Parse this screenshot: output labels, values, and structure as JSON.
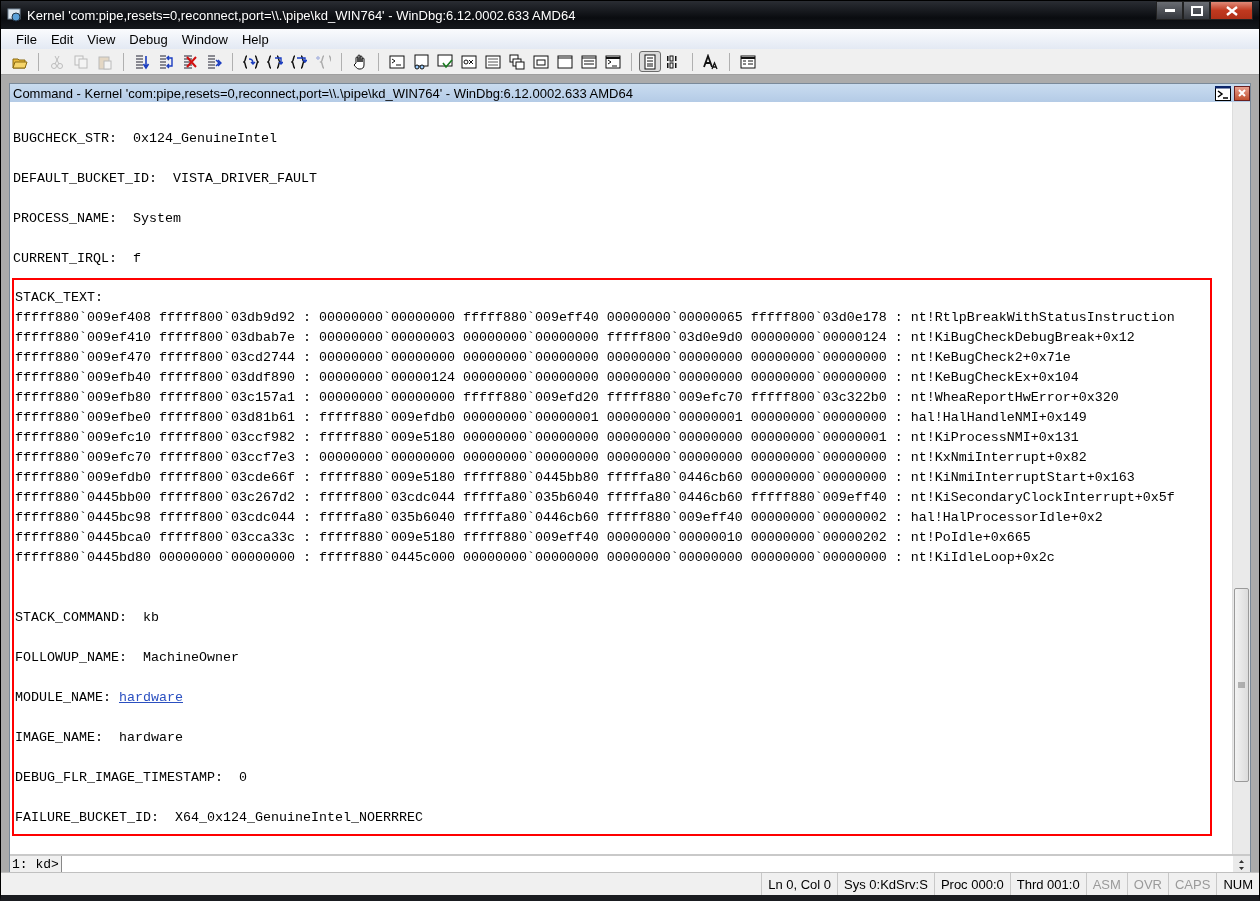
{
  "window": {
    "title": "Kernel 'com:pipe,resets=0,reconnect,port=\\\\.\\pipe\\kd_WIN764' - WinDbg:6.12.0002.633 AMD64"
  },
  "menu": [
    "File",
    "Edit",
    "View",
    "Debug",
    "Window",
    "Help"
  ],
  "toolbar": [
    [
      {
        "disabled": false,
        "pressed": false
      }
    ],
    [
      {
        "disabled": true,
        "pressed": false
      },
      {
        "disabled": true,
        "pressed": false
      },
      {
        "disabled": true,
        "pressed": false
      }
    ],
    [
      {
        "disabled": false,
        "pressed": false
      },
      {
        "disabled": false,
        "pressed": false
      },
      {
        "disabled": false,
        "pressed": false
      },
      {
        "disabled": false,
        "pressed": false
      }
    ],
    [
      {
        "disabled": false,
        "pressed": false
      },
      {
        "disabled": false,
        "pressed": false
      },
      {
        "disabled": false,
        "pressed": false
      },
      {
        "disabled": true,
        "pressed": false
      }
    ],
    [
      {
        "disabled": false,
        "pressed": false
      }
    ],
    [
      {
        "disabled": false,
        "pressed": false
      },
      {
        "disabled": false,
        "pressed": false
      },
      {
        "disabled": false,
        "pressed": false
      },
      {
        "disabled": false,
        "pressed": false
      },
      {
        "disabled": false,
        "pressed": false
      },
      {
        "disabled": false,
        "pressed": false
      },
      {
        "disabled": false,
        "pressed": false
      },
      {
        "disabled": false,
        "pressed": false
      },
      {
        "disabled": false,
        "pressed": false
      },
      {
        "disabled": false,
        "pressed": false
      }
    ],
    [
      {
        "disabled": false,
        "pressed": true
      },
      {
        "disabled": false,
        "pressed": false
      }
    ],
    [
      {
        "disabled": false,
        "pressed": false
      }
    ],
    [
      {
        "disabled": false,
        "pressed": false
      }
    ]
  ],
  "command_window": {
    "title": "Command - Kernel 'com:pipe,resets=0,reconnect,port=\\\\.\\pipe\\kd_WIN764' - WinDbg:6.12.0002.633 AMD64",
    "output": [
      {
        "kind": "blank"
      },
      {
        "kind": "field",
        "label": "BUGCHECK_STR:",
        "value": "0x124_GenuineIntel"
      },
      {
        "kind": "blank"
      },
      {
        "kind": "field",
        "label": "DEFAULT_BUCKET_ID:",
        "value": "VISTA_DRIVER_FAULT"
      },
      {
        "kind": "blank"
      },
      {
        "kind": "field",
        "label": "PROCESS_NAME:",
        "value": "System"
      },
      {
        "kind": "blank"
      },
      {
        "kind": "field",
        "label": "CURRENT_IRQL:",
        "value": "f"
      }
    ],
    "highlighted": [
      {
        "kind": "heading",
        "text": "STACK_TEXT:"
      },
      {
        "kind": "frame",
        "text": "fffff880`009ef408 fffff800`03db9d92 : 00000000`00000000 fffff880`009eff40 00000000`00000065 fffff800`03d0e178 : nt!RtlpBreakWithStatusInstruction"
      },
      {
        "kind": "frame",
        "text": "fffff880`009ef410 fffff800`03dbab7e : 00000000`00000003 00000000`00000000 fffff800`03d0e9d0 00000000`00000124 : nt!KiBugCheckDebugBreak+0x12"
      },
      {
        "kind": "frame",
        "text": "fffff880`009ef470 fffff800`03cd2744 : 00000000`00000000 00000000`00000000 00000000`00000000 00000000`00000000 : nt!KeBugCheck2+0x71e"
      },
      {
        "kind": "frame",
        "text": "fffff880`009efb40 fffff800`03ddf890 : 00000000`00000124 00000000`00000000 00000000`00000000 00000000`00000000 : nt!KeBugCheckEx+0x104"
      },
      {
        "kind": "frame",
        "text": "fffff880`009efb80 fffff800`03c157a1 : 00000000`00000000 fffff880`009efd20 fffff880`009efc70 fffff800`03c322b0 : nt!WheaReportHwError+0x320"
      },
      {
        "kind": "frame",
        "text": "fffff880`009efbe0 fffff800`03d81b61 : fffff880`009efdb0 00000000`00000001 00000000`00000001 00000000`00000000 : hal!HalHandleNMI+0x149"
      },
      {
        "kind": "frame",
        "text": "fffff880`009efc10 fffff800`03ccf982 : fffff880`009e5180 00000000`00000000 00000000`00000000 00000000`00000001 : nt!KiProcessNMI+0x131"
      },
      {
        "kind": "frame",
        "text": "fffff880`009efc70 fffff800`03ccf7e3 : 00000000`00000000 00000000`00000000 00000000`00000000 00000000`00000000 : nt!KxNmiInterrupt+0x82"
      },
      {
        "kind": "frame",
        "text": "fffff880`009efdb0 fffff800`03cde66f : fffff880`009e5180 fffff880`0445bb80 fffffa80`0446cb60 00000000`00000000 : nt!KiNmiInterruptStart+0x163"
      },
      {
        "kind": "frame",
        "text": "fffff880`0445bb00 fffff800`03c267d2 : fffff800`03cdc044 fffffa80`035b6040 fffffa80`0446cb60 fffff880`009eff40 : nt!KiSecondaryClockInterrupt+0x5f"
      },
      {
        "kind": "frame",
        "text": "fffff880`0445bc98 fffff800`03cdc044 : fffffa80`035b6040 fffffa80`0446cb60 fffff880`009eff40 00000000`00000002 : hal!HalProcessorIdle+0x2"
      },
      {
        "kind": "frame",
        "text": "fffff880`0445bca0 fffff800`03cca33c : fffff880`009e5180 fffff880`009eff40 00000000`00000010 00000000`00000202 : nt!PoIdle+0x665"
      },
      {
        "kind": "frame",
        "text": "fffff880`0445bd80 00000000`00000000 : fffff880`0445c000 00000000`00000000 00000000`00000000 00000000`00000000 : nt!KiIdleLoop+0x2c"
      },
      {
        "kind": "blank"
      },
      {
        "kind": "blank"
      },
      {
        "kind": "field",
        "label": "STACK_COMMAND:",
        "value": "kb"
      },
      {
        "kind": "blank"
      },
      {
        "kind": "field",
        "label": "FOLLOWUP_NAME:",
        "value": "MachineOwner"
      },
      {
        "kind": "blank"
      },
      {
        "kind": "link_field",
        "label": "MODULE_NAME:",
        "value": "hardware"
      },
      {
        "kind": "blank"
      },
      {
        "kind": "field",
        "label": "IMAGE_NAME:",
        "value": "hardware"
      },
      {
        "kind": "blank"
      },
      {
        "kind": "field",
        "label": "DEBUG_FLR_IMAGE_TIMESTAMP:",
        "value": "0"
      },
      {
        "kind": "blank"
      },
      {
        "kind": "field",
        "label": "FAILURE_BUCKET_ID:",
        "value": "X64_0x124_GenuineIntel_NOERRREC"
      }
    ],
    "prompt": "1: kd>"
  },
  "status_bar": [
    {
      "text": "Ln 0, Col 0",
      "on": true
    },
    {
      "text": "Sys 0:KdSrv:S",
      "on": true
    },
    {
      "text": "Proc 000:0",
      "on": true
    },
    {
      "text": "Thrd 001:0",
      "on": true
    },
    {
      "text": "ASM",
      "on": false
    },
    {
      "text": "OVR",
      "on": false
    },
    {
      "text": "CAPS",
      "on": false
    },
    {
      "text": "NUM",
      "on": true
    }
  ]
}
